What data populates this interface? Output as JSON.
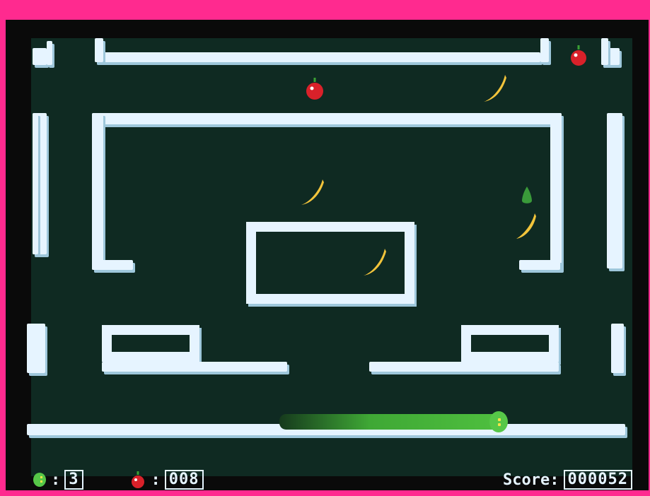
{
  "hud": {
    "lives_label": ":",
    "lives_value": "3",
    "apples_label": ":",
    "apples_value": "008",
    "score_label": "Score:",
    "score_value": "000052"
  },
  "colors": {
    "frame": "#ff2a8f",
    "wall": "#e6f4ff",
    "floor": "#0f2a22",
    "snake": "#4fc03f",
    "apple": "#d9212a",
    "banana": "#f2c43b"
  },
  "icons": [
    "snake-life-icon",
    "apple-counter-icon",
    "apple-icon",
    "banana-icon",
    "pear-icon"
  ]
}
